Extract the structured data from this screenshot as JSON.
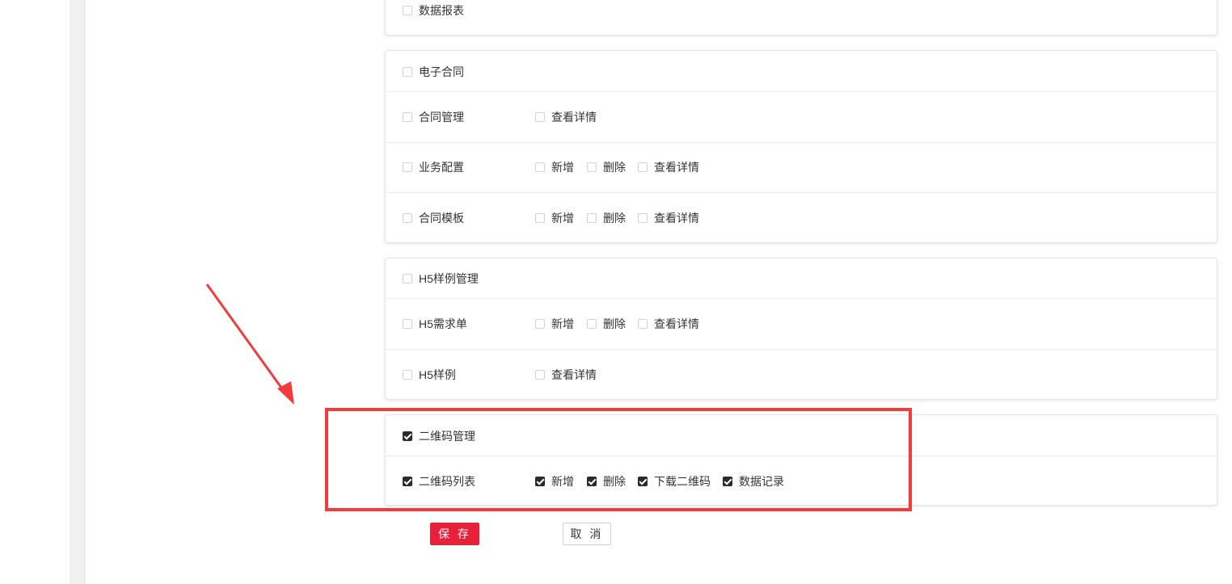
{
  "sections": [
    {
      "header": {
        "label": "数据报表",
        "checked": false
      },
      "rows": []
    },
    {
      "header": {
        "label": "电子合同",
        "checked": false
      },
      "rows": [
        {
          "label": "合同管理",
          "checked": false,
          "perms": [
            {
              "label": "查看详情",
              "checked": false
            }
          ]
        },
        {
          "label": "业务配置",
          "checked": false,
          "perms": [
            {
              "label": "新增",
              "checked": false
            },
            {
              "label": "删除",
              "checked": false
            },
            {
              "label": "查看详情",
              "checked": false
            }
          ]
        },
        {
          "label": "合同模板",
          "checked": false,
          "perms": [
            {
              "label": "新增",
              "checked": false
            },
            {
              "label": "删除",
              "checked": false
            },
            {
              "label": "查看详情",
              "checked": false
            }
          ]
        }
      ]
    },
    {
      "header": {
        "label": "H5样例管理",
        "checked": false
      },
      "rows": [
        {
          "label": "H5需求单",
          "checked": false,
          "perms": [
            {
              "label": "新增",
              "checked": false
            },
            {
              "label": "删除",
              "checked": false
            },
            {
              "label": "查看详情",
              "checked": false
            }
          ]
        },
        {
          "label": "H5样例",
          "checked": false,
          "perms": [
            {
              "label": "查看详情",
              "checked": false
            }
          ]
        }
      ]
    },
    {
      "header": {
        "label": "二维码管理",
        "checked": true
      },
      "rows": [
        {
          "label": "二维码列表",
          "checked": true,
          "perms": [
            {
              "label": "新增",
              "checked": true
            },
            {
              "label": "删除",
              "checked": true
            },
            {
              "label": "下载二维码",
              "checked": true
            },
            {
              "label": "数据记录",
              "checked": true
            }
          ]
        }
      ]
    }
  ],
  "actions": {
    "save_label": "保 存",
    "cancel_label": "取 消"
  },
  "colors": {
    "annotation_red": "#f23c3c",
    "primary_button": "#e8203a",
    "checkbox_checked": "#2b2b2b"
  }
}
